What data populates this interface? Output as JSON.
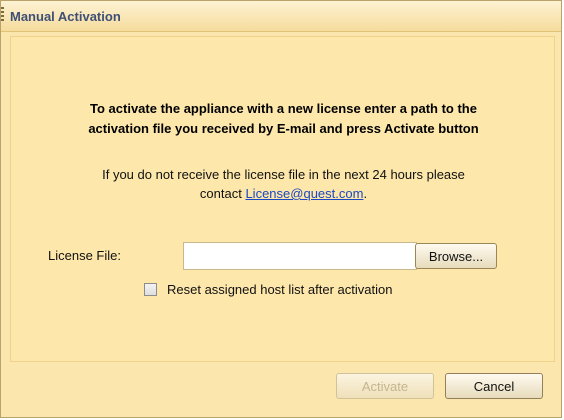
{
  "dialog": {
    "title": "Manual Activation",
    "heading_line1": "To activate the appliance with a new license enter a path to the",
    "heading_line2": "activation file you received by E-mail and press Activate button",
    "info_line1": "If you do not receive the license file in the next 24 hours please",
    "info_line2_prefix": "contact ",
    "info_link": "License@quest.com",
    "info_line2_suffix": ".",
    "license_label": "License File:",
    "license_value": "",
    "browse_label": "Browse...",
    "reset_checkbox_label": "Reset assigned host list after activation",
    "reset_checked": false,
    "activate_label": "Activate",
    "activate_enabled": false,
    "cancel_label": "Cancel"
  },
  "colors": {
    "background": "#fbe6ad",
    "title_text": "#3f4f76",
    "link": "#1b47c4"
  }
}
